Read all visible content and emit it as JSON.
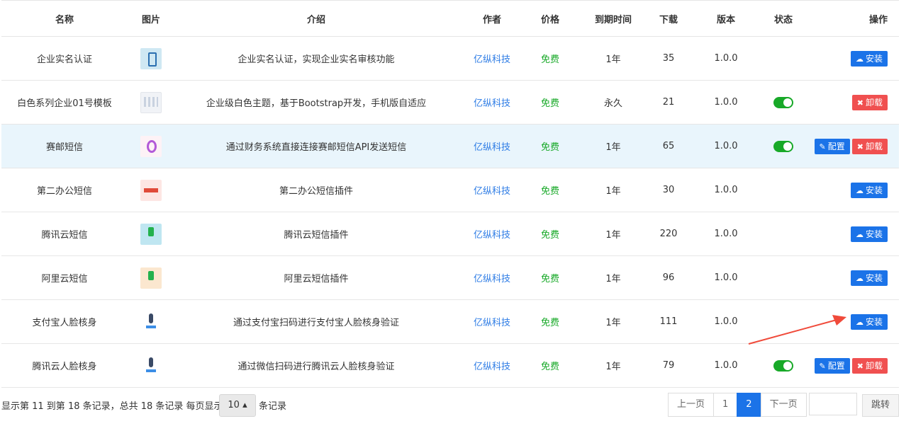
{
  "table": {
    "headers": {
      "name": "名称",
      "image": "图片",
      "intro": "介绍",
      "author": "作者",
      "price": "价格",
      "expiry": "到期时间",
      "downloads": "下载",
      "version": "版本",
      "status": "状态",
      "actions": "操作"
    },
    "rows": [
      {
        "name": "企业实名认证",
        "intro": "企业实名认证，实现企业实名审核功能",
        "author": "亿纵科技",
        "price": "免费",
        "expiry": "1年",
        "downloads": "35",
        "version": "1.0.0"
      },
      {
        "name": "白色系列企业01号模板",
        "intro": "企业级白色主题，基于Bootstrap开发，手机版自适应",
        "author": "亿纵科技",
        "price": "免费",
        "expiry": "永久",
        "downloads": "21",
        "version": "1.0.0"
      },
      {
        "name": "赛邮短信",
        "intro": "通过财务系统直接连接赛邮短信API发送短信",
        "author": "亿纵科技",
        "price": "免费",
        "expiry": "1年",
        "downloads": "65",
        "version": "1.0.0"
      },
      {
        "name": "第二办公短信",
        "intro": "第二办公短信插件",
        "author": "亿纵科技",
        "price": "免费",
        "expiry": "1年",
        "downloads": "30",
        "version": "1.0.0"
      },
      {
        "name": "腾讯云短信",
        "intro": "腾讯云短信插件",
        "author": "亿纵科技",
        "price": "免费",
        "expiry": "1年",
        "downloads": "220",
        "version": "1.0.0"
      },
      {
        "name": "阿里云短信",
        "intro": "阿里云短信插件",
        "author": "亿纵科技",
        "price": "免费",
        "expiry": "1年",
        "downloads": "96",
        "version": "1.0.0"
      },
      {
        "name": "支付宝人脸核身",
        "intro": "通过支付宝扫码进行支付宝人脸核身验证",
        "author": "亿纵科技",
        "price": "免费",
        "expiry": "1年",
        "downloads": "111",
        "version": "1.0.0"
      },
      {
        "name": "腾讯云人脸核身",
        "intro": "通过微信扫码进行腾讯云人脸核身验证",
        "author": "亿纵科技",
        "price": "免费",
        "expiry": "1年",
        "downloads": "79",
        "version": "1.0.0"
      }
    ]
  },
  "buttons": {
    "install": "安装",
    "uninstall": "卸载",
    "config": "配置"
  },
  "footer": {
    "summary": "显示第 11 到第 18 条记录，总共 18 条记录 每页显示",
    "page_size": "10 ▴",
    "suffix": "条记录"
  },
  "pager": {
    "prev": "上一页",
    "page1": "1",
    "page2": "2",
    "next": "下一页",
    "jump": "跳转"
  }
}
